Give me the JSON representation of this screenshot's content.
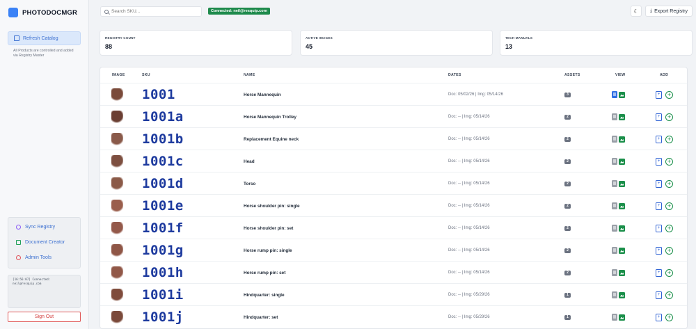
{
  "app": {
    "name": "PHOTODOCMGR"
  },
  "sidebar": {
    "refresh_label": "Refresh Catalog",
    "note": "All Products are controlled and added via Registry Master",
    "tools": [
      {
        "label": "Sync Registry",
        "icon": "sync-icon"
      },
      {
        "label": "Document Creator",
        "icon": "document-icon"
      },
      {
        "label": "Admin Tools",
        "icon": "admin-icon"
      }
    ],
    "log": "[16:56:07] Connected:\nneil@resquip.com",
    "signout_label": "Sign Out"
  },
  "topbar": {
    "search_placeholder": "Search SKU...",
    "connection": "Connected: neil@resquip.com",
    "export_label": "Export Registry"
  },
  "stats": [
    {
      "label": "REGISTRY COUNT",
      "value": "88"
    },
    {
      "label": "ACTIVE IMAGES",
      "value": "45"
    },
    {
      "label": "TECH MANUALS",
      "value": "13"
    }
  ],
  "table": {
    "headers": {
      "image": "IMAGE",
      "sku": "SKU",
      "name": "NAME",
      "dates": "DATES",
      "assets": "ASSETS",
      "view": "VIEW",
      "add": "ADD"
    },
    "rows": [
      {
        "sku": "1001",
        "name": "Horse Mannequin",
        "dates": "Doc: 05/02/26 | Img: 05/14/26",
        "assets": "3",
        "doc_active": true,
        "thumb_color": "#7a4a3a"
      },
      {
        "sku": "1001a",
        "name": "Horse Mannequin Trolley",
        "dates": "Doc: -- | Img: 05/14/26",
        "assets": "2",
        "doc_active": false,
        "thumb_color": "#6b3f33"
      },
      {
        "sku": "1001b",
        "name": "Replacement Equine neck",
        "dates": "Doc: -- | Img: 05/14/26",
        "assets": "2",
        "doc_active": false,
        "thumb_color": "#8a5a4a"
      },
      {
        "sku": "1001c",
        "name": "Head",
        "dates": "Doc: -- | Img: 05/14/26",
        "assets": "2",
        "doc_active": false,
        "thumb_color": "#7d4f40"
      },
      {
        "sku": "1001d",
        "name": "Torso",
        "dates": "Doc: -- | Img: 05/14/26",
        "assets": "2",
        "doc_active": false,
        "thumb_color": "#8b5a48"
      },
      {
        "sku": "1001e",
        "name": "Horse shoulder pin: single",
        "dates": "Doc: -- | Img: 05/14/26",
        "assets": "2",
        "doc_active": false,
        "thumb_color": "#9a5e4c"
      },
      {
        "sku": "1001f",
        "name": "Horse shoulder pin: set",
        "dates": "Doc: -- | Img: 05/14/26",
        "assets": "2",
        "doc_active": false,
        "thumb_color": "#94594a"
      },
      {
        "sku": "1001g",
        "name": "Horse rump pin: single",
        "dates": "Doc: -- | Img: 05/14/26",
        "assets": "2",
        "doc_active": false,
        "thumb_color": "#8f5646"
      },
      {
        "sku": "1001h",
        "name": "Horse rump pin: set",
        "dates": "Doc: -- | Img: 05/14/26",
        "assets": "2",
        "doc_active": false,
        "thumb_color": "#915848"
      },
      {
        "sku": "1001i",
        "name": "Hindquarter: single",
        "dates": "Doc: -- | Img: 05/29/26",
        "assets": "1",
        "doc_active": false,
        "thumb_color": "#7f4c3c"
      },
      {
        "sku": "1001j",
        "name": "Hindquarter: set",
        "dates": "Doc: -- | Img: 05/29/26",
        "assets": "1",
        "doc_active": false,
        "thumb_color": "#7b4a3b"
      }
    ]
  },
  "colors": {
    "accent": "#3b82f6",
    "sku_text": "#1d3a9e",
    "connected_badge": "#1e8a4c",
    "signout": "#d23b3b"
  }
}
